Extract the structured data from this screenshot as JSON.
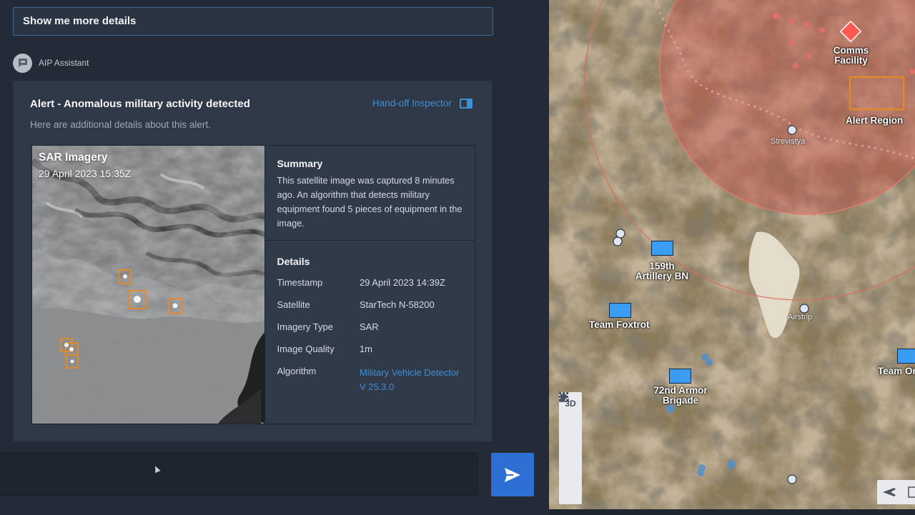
{
  "query": {
    "text": "Show me more details"
  },
  "assistant": {
    "name": "AIP Assistant"
  },
  "alert": {
    "title": "Alert - Anomalous military activity detected",
    "subtitle": "Here are additional details about this alert.",
    "handoff_label": "Hand-off Inspector"
  },
  "imagery": {
    "title": "SAR Imagery",
    "datetime": "29 April 2023 15:35Z"
  },
  "summary": {
    "heading": "Summary",
    "text": "This satellite image was captured 8 minutes ago. An algorithm that detects military equipment found 5 pieces of equipment in the image."
  },
  "details": {
    "heading": "Details",
    "rows": [
      {
        "key": "Timestamp",
        "value": "29 April 2023 14:39Z"
      },
      {
        "key": "Satellite",
        "value": "StarTech N-58200"
      },
      {
        "key": "Imagery Type",
        "value": "SAR"
      },
      {
        "key": "Image Quality",
        "value": "1m"
      },
      {
        "key": "Algorithm",
        "value": "Military Vehicle Detector V 25.3.0"
      }
    ]
  },
  "map": {
    "labels": {
      "comms": "Comms Facility",
      "alert_region": "Alert Region",
      "strevistya": "Strevistya",
      "airstrip": "Airstrip",
      "artillery": "159th Artillery BN",
      "foxtrot": "Team Foxtrot",
      "armor": "72nd Armor Brigade",
      "team_or": "Team Or"
    },
    "tools": [
      "3D",
      "grid-icon",
      "eraser-icon",
      "navigate-icon",
      "upload-icon"
    ],
    "colors": {
      "threat_zone": "#c9574f",
      "unit": "#3a9cf2",
      "alert_box": "#e08a2c"
    }
  }
}
